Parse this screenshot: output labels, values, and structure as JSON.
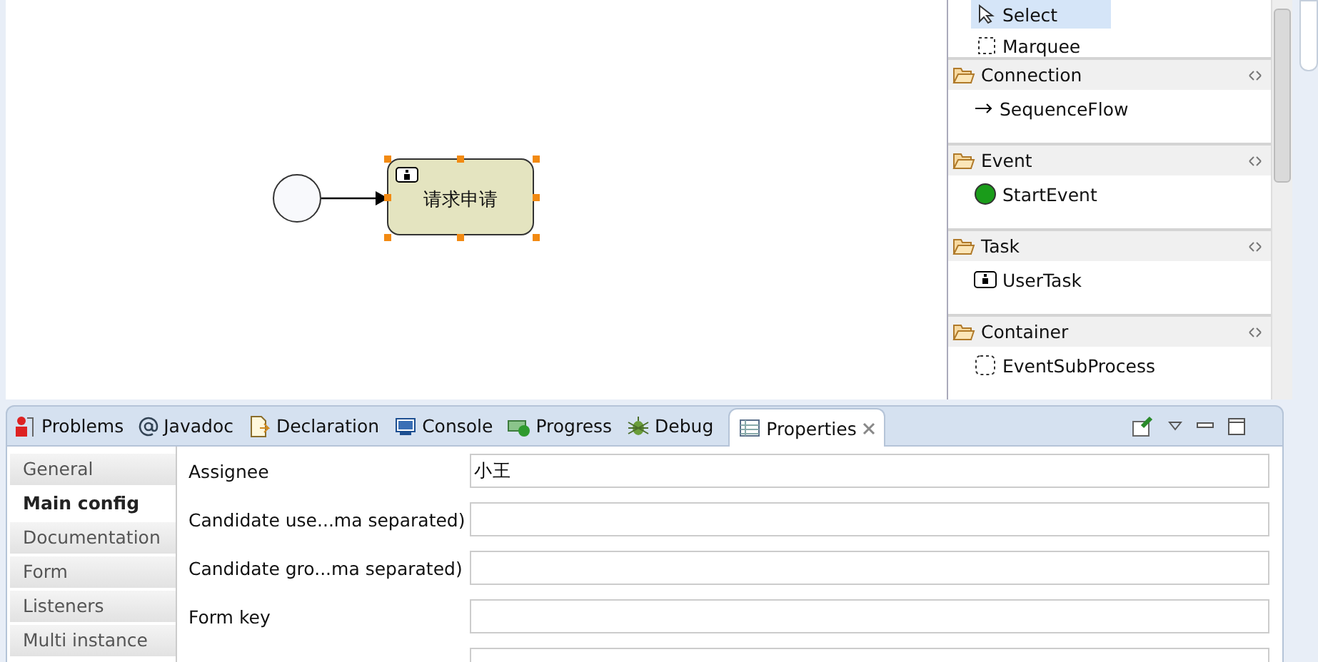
{
  "diagram": {
    "task_label": "请求申请"
  },
  "palette": {
    "tools": [
      {
        "label": "Select",
        "kind": "select",
        "selected": true
      },
      {
        "label": "Marquee",
        "kind": "marquee",
        "selected": false
      }
    ],
    "drawers": [
      {
        "title": "Connection",
        "items": [
          {
            "label": "SequenceFlow",
            "kind": "flow"
          }
        ]
      },
      {
        "title": "Event",
        "items": [
          {
            "label": "StartEvent",
            "kind": "start"
          }
        ]
      },
      {
        "title": "Task",
        "items": [
          {
            "label": "UserTask",
            "kind": "user"
          }
        ]
      },
      {
        "title": "Container",
        "items": [
          {
            "label": "EventSubProcess",
            "kind": "subprocess"
          }
        ]
      }
    ]
  },
  "view_tabs": [
    {
      "label": "Problems",
      "kind": "problems",
      "selected": false
    },
    {
      "label": "Javadoc",
      "kind": "javadoc",
      "selected": false
    },
    {
      "label": "Declaration",
      "kind": "declaration",
      "selected": false
    },
    {
      "label": "Console",
      "kind": "console",
      "selected": false
    },
    {
      "label": "Progress",
      "kind": "progress",
      "selected": false
    },
    {
      "label": "Debug",
      "kind": "debug",
      "selected": false
    },
    {
      "label": "Properties",
      "kind": "properties",
      "selected": true
    }
  ],
  "property_sections": [
    {
      "label": "General",
      "selected": false
    },
    {
      "label": "Main config",
      "selected": true
    },
    {
      "label": "Documentation",
      "selected": false
    },
    {
      "label": "Form",
      "selected": false
    },
    {
      "label": "Listeners",
      "selected": false
    },
    {
      "label": "Multi instance",
      "selected": false
    }
  ],
  "fields": [
    {
      "label": "Assignee",
      "value": "小王"
    },
    {
      "label": "Candidate use...ma separated)"
    },
    {
      "label": "Candidate gro...ma separated)"
    },
    {
      "label": "Form key"
    }
  ]
}
